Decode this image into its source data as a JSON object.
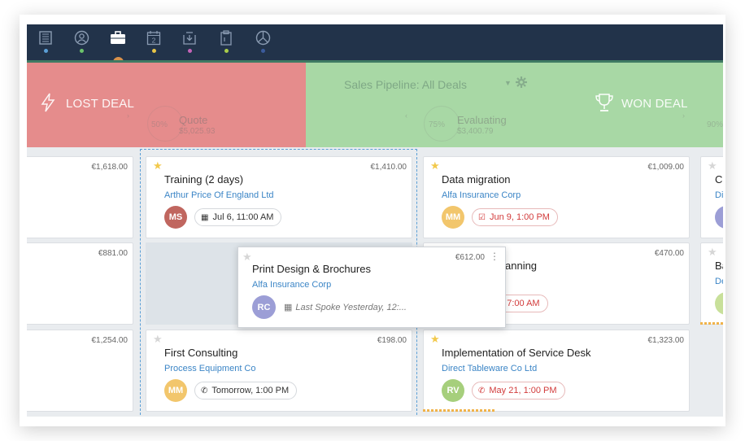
{
  "nav": {
    "icons": [
      {
        "name": "building-icon",
        "glyph": "▥",
        "dot": "#5b9fd6"
      },
      {
        "name": "contacts-icon",
        "glyph": "◎",
        "dot": "#6cc36c"
      },
      {
        "name": "deals-briefcase-icon",
        "glyph": "▬",
        "dot": ""
      },
      {
        "name": "calendar-icon",
        "glyph": "▭",
        "dot": "#e8c547"
      },
      {
        "name": "inbox-icon",
        "glyph": "⇩",
        "dot": "#c564b8"
      },
      {
        "name": "documents-icon",
        "glyph": "▯",
        "dot": "#aacd4a"
      },
      {
        "name": "reports-icon",
        "glyph": "◔",
        "dot": "#3b5b9c"
      }
    ],
    "calendar_day": "2"
  },
  "zones": {
    "lost_label": "LOST DEAL",
    "won_label": "WON DEAL"
  },
  "pipeline": {
    "title": "Sales Pipeline: All Deals"
  },
  "stages": [
    {
      "pct": "50%",
      "name": "Quote",
      "amount": "$5,025.93"
    },
    {
      "pct": "75%",
      "name": "Evaluating",
      "amount": "$3,400.79"
    },
    {
      "pct": "90%"
    }
  ],
  "columns": {
    "left": {
      "amounts": [
        "€1,618.00",
        "€881.00",
        "€1,254.00"
      ]
    },
    "quote": {
      "cards": [
        {
          "starred": true,
          "amount": "€1,410.00",
          "title": "Training (2 days)",
          "org": "Arthur Price Of England Ltd",
          "initials": "MS",
          "avatar_color": "#c0665f",
          "activity": "Jul 6, 11:00 AM",
          "activity_icon": "calendar",
          "overdue": false
        },
        {
          "starred": false,
          "amount": "€198.00",
          "title": "First Consulting",
          "org": "Process Equipment Co",
          "initials": "MM",
          "avatar_color": "#f2c66c",
          "activity": "Tomorrow, 1:00 PM",
          "activity_icon": "phone",
          "overdue": false
        }
      ]
    },
    "evaluating": {
      "cards": [
        {
          "starred": true,
          "amount": "€1,009.00",
          "title": "Data migration",
          "org": "Alfa Insurance Corp",
          "initials": "MM",
          "avatar_color": "#f2c66c",
          "activity": "Jun 9, 1:00 PM",
          "activity_icon": "task",
          "overdue": true
        },
        {
          "starred": false,
          "amount": "€470.00",
          "title_partial": "anning",
          "activity_partial": "2, 7:00 AM",
          "overdue": true
        },
        {
          "starred": true,
          "amount": "€1,323.00",
          "title": "Implementation of Service Desk",
          "org": "Direct Tableware Co Ltd",
          "initials": "RV",
          "avatar_color": "#a6cf7c",
          "activity": "May 21, 1:00 PM",
          "activity_icon": "phone",
          "overdue": true
        }
      ]
    },
    "right": {
      "cards": [
        {
          "title_partial": "Cr",
          "org_partial": "Di",
          "avatar_partial": "R",
          "avatar_color": "#9c9ed6"
        },
        {
          "title_partial": "Ba",
          "org_partial": "De",
          "avatar_partial": "F",
          "avatar_color": "#c8e09a"
        }
      ]
    }
  },
  "dragged_card": {
    "amount": "€612.00",
    "title": "Print Design & Brochures",
    "org": "Alfa Insurance Corp",
    "initials": "RC",
    "last_spoke": "Last Spoke Yesterday, 12:..."
  },
  "colors": {
    "nav_bg": "#22334a",
    "lost_zone": "#e58c8c",
    "won_zone": "#a8d8a5",
    "link": "#3b85c6",
    "star": "#f2c94c",
    "overdue": "#d23b3b"
  }
}
